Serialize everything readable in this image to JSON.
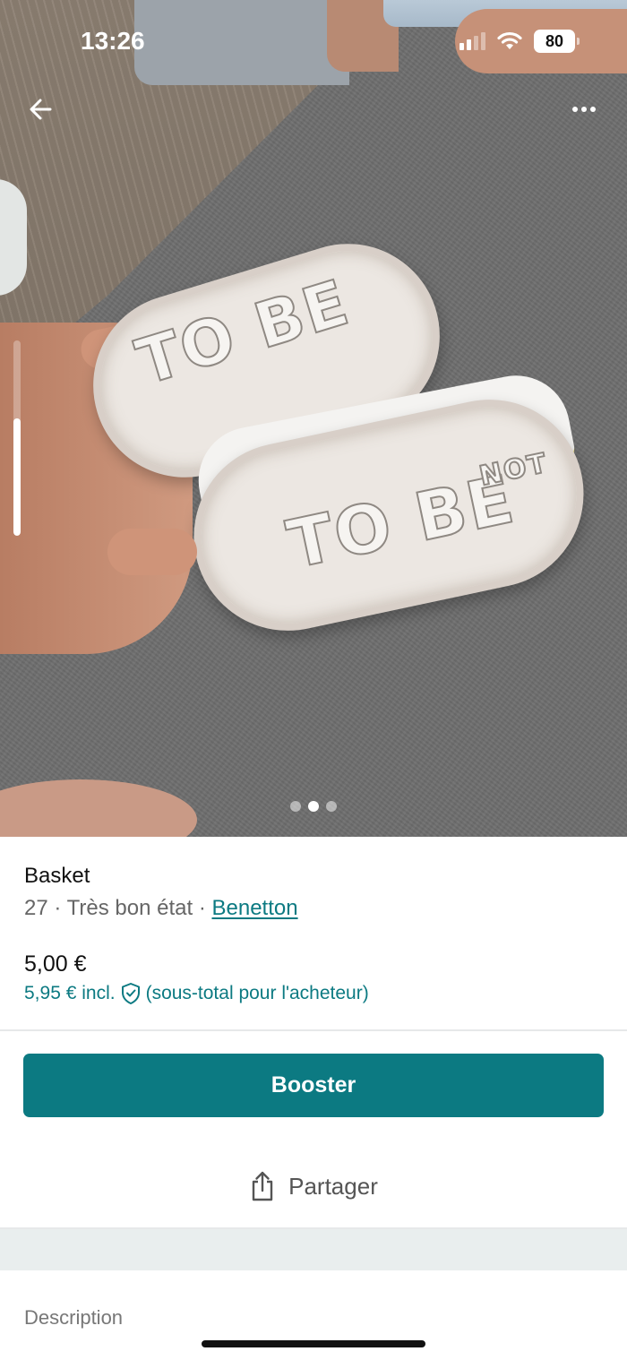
{
  "status_bar": {
    "time": "13:26",
    "battery": "80",
    "icons": [
      "signal-icon",
      "wifi-icon",
      "battery-icon"
    ]
  },
  "header": {
    "back_icon": "arrow-left-icon",
    "more_icon": "more-horizontal-icon"
  },
  "gallery": {
    "photo_count": 3,
    "active_index": 1,
    "sole_text_left": "TO BE",
    "sole_text_right": "TO BE",
    "sole_text_right_small": "NOT",
    "scroll_progress": 0.6
  },
  "item": {
    "title": "Basket",
    "size": "27",
    "separator": "·",
    "condition": "Très bon état",
    "brand": "Benetton",
    "price": "5,00 €",
    "price_incl": "5,95 € incl.",
    "price_incl_note": "(sous-total pour l'acheteur)"
  },
  "actions": {
    "booster_label": "Booster",
    "share_label": "Partager"
  },
  "description": {
    "label": "Description"
  },
  "colors": {
    "accent": "#0c7a82",
    "text_secondary": "#666666"
  }
}
